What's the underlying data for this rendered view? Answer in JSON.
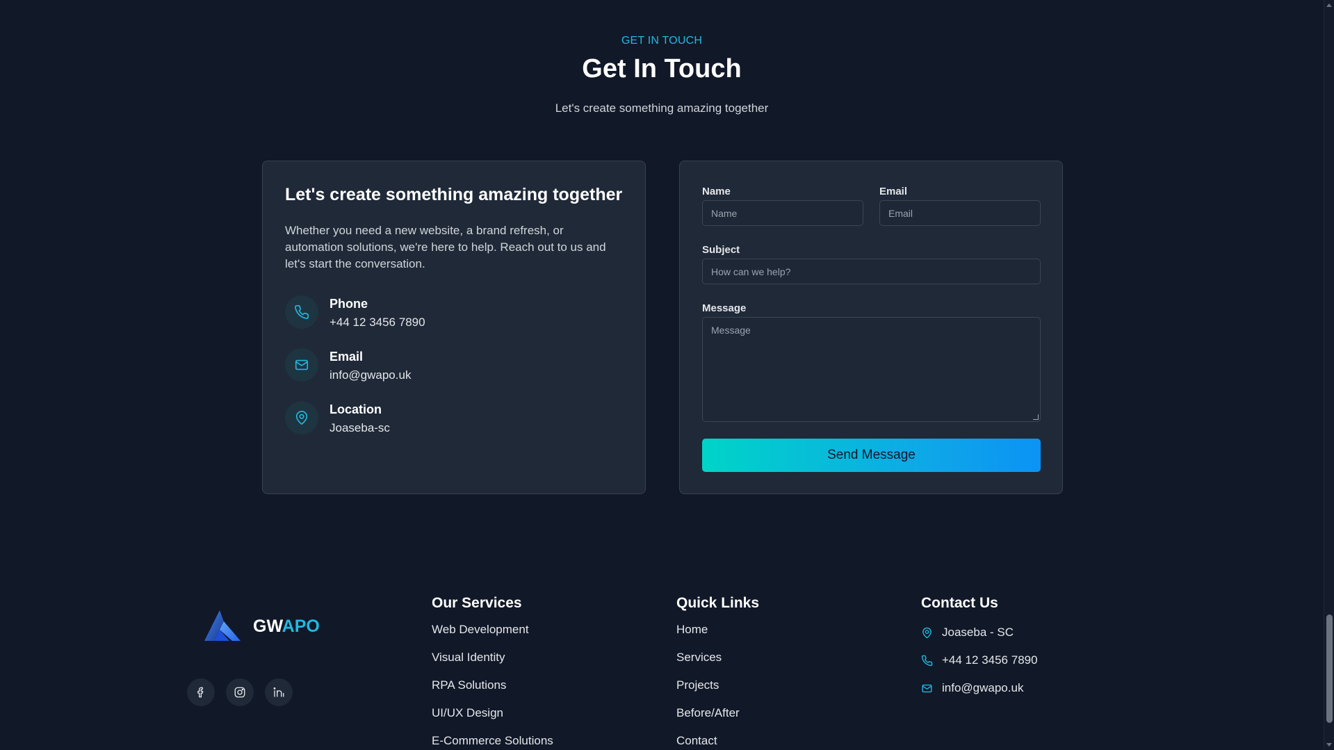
{
  "header": {
    "eyebrow": "GET IN TOUCH",
    "title": "Get In Touch",
    "subtitle": "Let's create something amazing together"
  },
  "info_card": {
    "title": "Let's create something amazing together",
    "text": "Whether you need a new website, a brand refresh, or automation solutions, we're here to help. Reach out to us and let's start the conversation.",
    "contacts": [
      {
        "label": "Phone",
        "value": "+44 12 3456 7890",
        "icon": "phone-icon"
      },
      {
        "label": "Email",
        "value": "info@gwapo.uk",
        "icon": "mail-icon"
      },
      {
        "label": "Location",
        "value": "Joaseba-sc",
        "icon": "location-pin-icon"
      }
    ]
  },
  "form": {
    "name_label": "Name",
    "name_placeholder": "Name",
    "email_label": "Email",
    "email_placeholder": "Email",
    "subject_label": "Subject",
    "subject_placeholder": "How can we help?",
    "message_label": "Message",
    "message_placeholder": "Message",
    "submit_label": "Send Message"
  },
  "footer": {
    "logo_prefix": "GW",
    "logo_suffix": "APO",
    "social": [
      "facebook-icon",
      "instagram-icon",
      "linkedin-icon"
    ],
    "services": {
      "heading": "Our Services",
      "links": [
        "Web Development",
        "Visual Identity",
        "RPA Solutions",
        "UI/UX Design",
        "E-Commerce Solutions"
      ]
    },
    "quick_links": {
      "heading": "Quick Links",
      "links": [
        "Home",
        "Services",
        "Projects",
        "Before/After",
        "Contact"
      ]
    },
    "contact": {
      "heading": "Contact Us",
      "location": "Joaseba - SC",
      "phone": "+44 12 3456 7890",
      "email": "info@gwapo.uk"
    }
  },
  "colors": {
    "background": "#111827",
    "card": "#1f2937",
    "accent": "#22b8e0",
    "button_gradient_start": "#00d4c8",
    "button_gradient_end": "#0b93f5"
  }
}
